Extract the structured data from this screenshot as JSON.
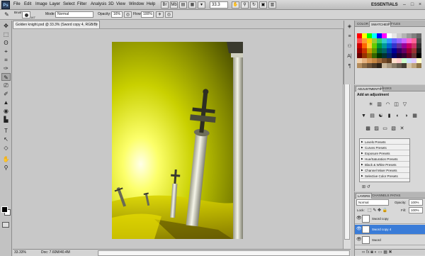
{
  "app": {
    "logo": "Ps",
    "zoom": "33.3",
    "workspace": "ESSENTIALS ▾"
  },
  "menus": [
    "File",
    "Edit",
    "Image",
    "Layer",
    "Select",
    "Filter",
    "Analysis",
    "3D",
    "View",
    "Window",
    "Help"
  ],
  "window_controls": {
    "minimize": "–",
    "maximize": "□",
    "close": "×"
  },
  "options": {
    "brush_label": "Brush:",
    "brush_size": "147",
    "mode_label": "Mode:",
    "mode_value": "Normal",
    "opacity_label": "Opacity:",
    "opacity_value": "16%",
    "flow_label": "Flow:",
    "flow_value": "100%"
  },
  "document": {
    "tab_title": "Golden knight.psd @ 33.3% (Sword copy 4, RGB/8)",
    "close": "×"
  },
  "status": {
    "zoom": "33.33%",
    "doc_size": "Doc: 7.60M/40.4M"
  },
  "swatches_panel": {
    "tabs": [
      "COLOR",
      "SWATCHES",
      "STYLES"
    ],
    "active": 1
  },
  "swatch_colors": [
    [
      "#ff0000",
      "#ffff00",
      "#00ff00",
      "#00ffff",
      "#0000ff",
      "#ff00ff",
      "#ffffff",
      "#e6e6e6",
      "#cccccc",
      "#b3b3b3",
      "#999999",
      "#808080",
      "#666666"
    ],
    [
      "#ff4d4d",
      "#ff9933",
      "#ffcc00",
      "#99cc33",
      "#33cc66",
      "#33cccc",
      "#3399ff",
      "#6666ff",
      "#9966ff",
      "#cc66ff",
      "#ff66cc",
      "#ff6699",
      "#4d4d4d"
    ],
    [
      "#cc0000",
      "#ff6600",
      "#ffcc33",
      "#66cc00",
      "#009933",
      "#009999",
      "#0066cc",
      "#3333cc",
      "#663399",
      "#990099",
      "#cc0066",
      "#cc3366",
      "#333333"
    ],
    [
      "#990000",
      "#cc3300",
      "#cc9900",
      "#669900",
      "#006633",
      "#006666",
      "#003399",
      "#000099",
      "#330066",
      "#660066",
      "#990033",
      "#993333",
      "#1a1a1a"
    ],
    [
      "#660000",
      "#993300",
      "#996600",
      "#336600",
      "#003300",
      "#003333",
      "#002266",
      "#000066",
      "#1a0033",
      "#330033",
      "#660022",
      "#663333",
      "#000000"
    ],
    [
      "#f2d0a9",
      "#e6b380",
      "#d9995a",
      "#c68642",
      "#a0693a",
      "#7a4f2b",
      "#5c3a1e",
      "#ffe0cc",
      "#ffcccc",
      "#ccffcc",
      "#cce0ff",
      "#e0ccff",
      "#ffffcc"
    ],
    [
      "#b38b5c",
      "#8c6b45",
      "#6b5035",
      "#4d3a26",
      "#2e2217",
      "#c9b79c",
      "#a89880",
      "#877a66",
      "#665c4d",
      "#453e34",
      "#d4c4a8",
      "#bfa57c",
      "#8f7547"
    ]
  ],
  "adjustments_panel": {
    "tabs": [
      "ADJUSTMENTS",
      "MASKS"
    ],
    "active": 0,
    "title": "Add an adjustment"
  },
  "adjustment_icons": [
    [
      "☀",
      "▥",
      "◠",
      "◫",
      "▽"
    ],
    [
      "▼",
      "▤",
      "☯",
      "▮",
      "◐",
      "◑",
      "▦"
    ],
    [
      "▩",
      "▨",
      "▭",
      "▧",
      "✕"
    ]
  ],
  "presets": [
    "Levels Presets",
    "Curves Presets",
    "Exposure Presets",
    "Hue/Saturation Presets",
    "Black & White Presets",
    "Channel Mixer Presets",
    "Selective Color Presets"
  ],
  "preset_footer": "⊞ ↺",
  "layers_panel": {
    "tabs": [
      "LAYERS",
      "CHANNELS",
      "PATHS"
    ],
    "active": 0,
    "blend_mode": "Normal",
    "opacity_label": "Opacity:",
    "opacity_value": "100%",
    "lock_label": "Lock:",
    "fill_label": "Fill:",
    "fill_value": "100%",
    "layers": [
      {
        "name": "Sword copy",
        "selected": false
      },
      {
        "name": "Sword copy 4",
        "selected": true
      },
      {
        "name": "Sword",
        "selected": false
      }
    ],
    "footer": "∞ fx ◙ ◐ ▭ ▦ ✖"
  },
  "tools": [
    "✥",
    "⬚",
    "ʘ",
    "⌖",
    "⌗",
    "✑",
    "✎",
    "⎚",
    "✐",
    "▲",
    "◉",
    "▙",
    "T",
    "↖",
    "◇",
    "✋",
    "⚲"
  ],
  "panel_strip_icons": [
    "◈",
    "≡",
    "⚇",
    "A|",
    "¶"
  ],
  "colors": {
    "selection_blue": "#3a7cd8",
    "canvas_glow": "#ffff9a",
    "canvas_dark": "#6b7000"
  }
}
